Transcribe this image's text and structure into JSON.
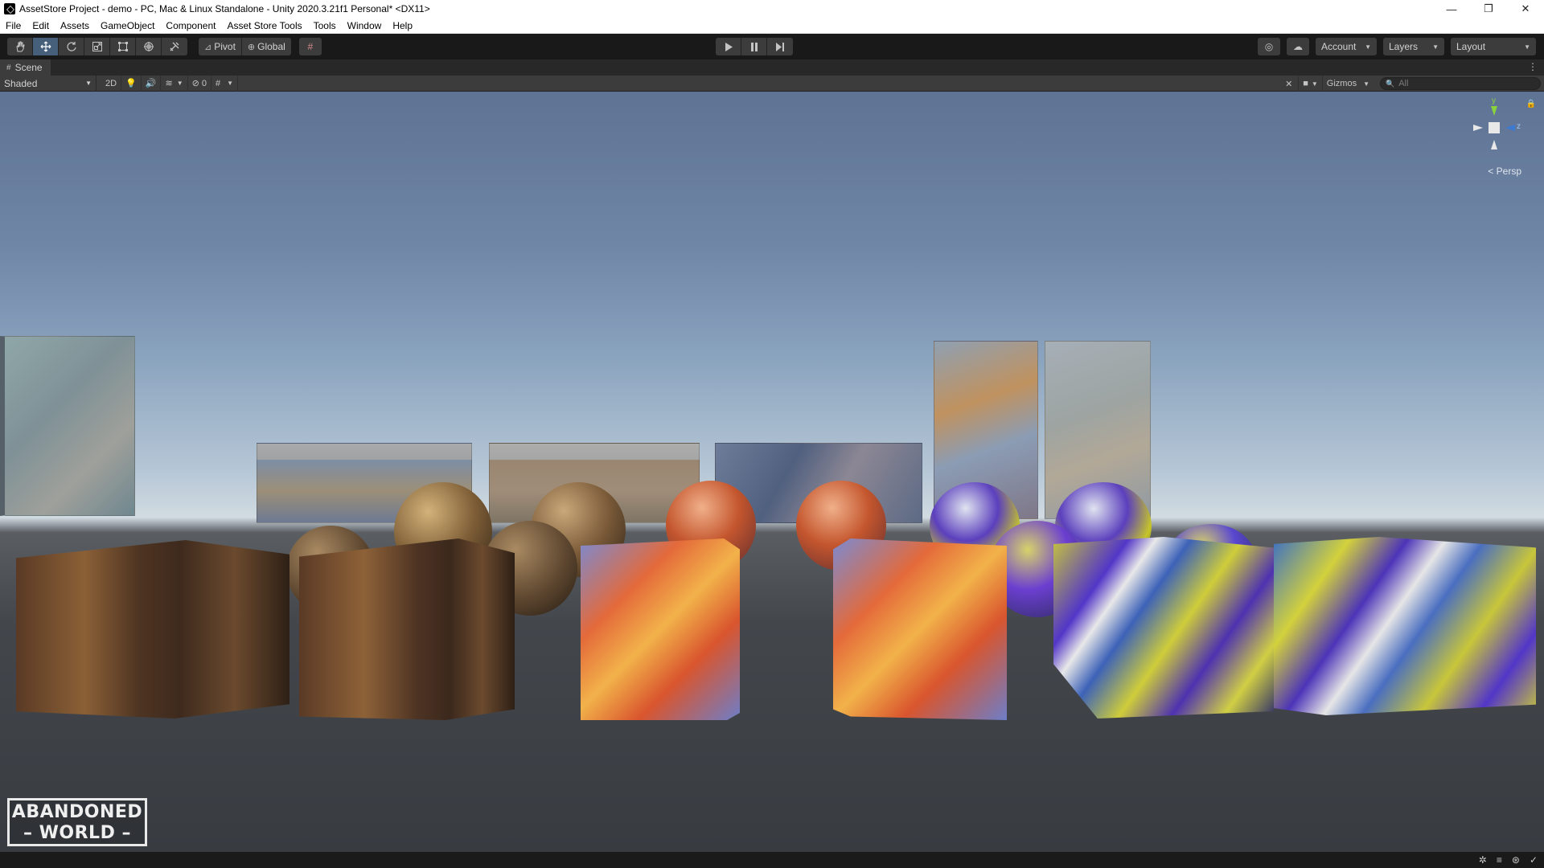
{
  "window": {
    "title": "AssetStore Project - demo - PC, Mac & Linux Standalone - Unity 2020.3.21f1 Personal* <DX11>",
    "minimize": "—",
    "maximize": "❐",
    "close": "✕"
  },
  "menu": [
    "File",
    "Edit",
    "Assets",
    "GameObject",
    "Component",
    "Asset Store Tools",
    "Tools",
    "Window",
    "Help"
  ],
  "toolbar": {
    "tools": [
      "hand-tool-icon",
      "move-tool-icon",
      "rotate-tool-icon",
      "scale-tool-icon",
      "rect-tool-icon",
      "transform-tool-icon",
      "custom-tool-icon"
    ],
    "active_tool": "move-tool-icon",
    "pivot_label": "Pivot",
    "global_label": "Global",
    "account_label": "Account",
    "layers_label": "Layers",
    "layout_label": "Layout"
  },
  "scene_tab": {
    "label": "Scene"
  },
  "scene_options": {
    "shading_mode": "Shaded",
    "mode_2d": "2D",
    "hidden_count": "0",
    "gizmos_label": "Gizmos",
    "search_placeholder": "All"
  },
  "gizmo": {
    "y_label": "y",
    "z_label": "z",
    "projection_label": "< Persp"
  },
  "logo": {
    "line1": "ABANDONED",
    "line2": "WORLD"
  },
  "colors": {
    "accent_active": "#46607c",
    "toolbar_bg": "#191919",
    "panel_bg": "#3c3c3c",
    "axis_y": "#8ad23c",
    "axis_z": "#3c7ad2"
  }
}
